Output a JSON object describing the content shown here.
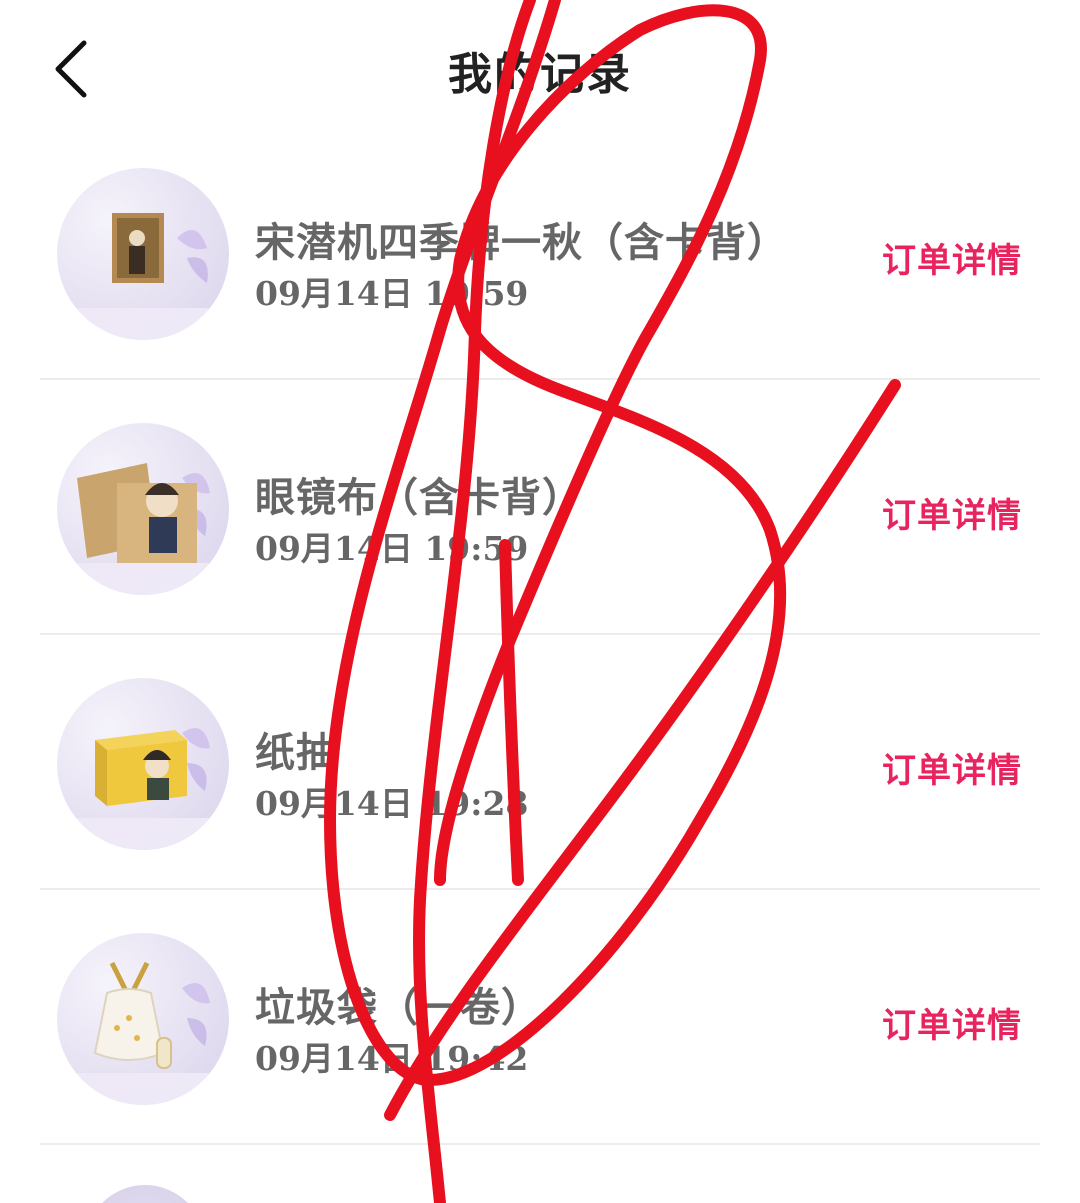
{
  "header": {
    "title": "我的记录",
    "back_icon": "chevron-left-icon"
  },
  "records": [
    {
      "name": "宋潜机四季牌一秋（含卡背）",
      "time": "09月14日 19:59",
      "detail_label": "订单详情",
      "thumb_icon": "card-product-icon"
    },
    {
      "name": "眼镜布（含卡背）",
      "time": "09月14日 19:59",
      "detail_label": "订单详情",
      "thumb_icon": "cloth-product-icon"
    },
    {
      "name": "纸抽",
      "time": "09月14日 19:28",
      "detail_label": "订单详情",
      "thumb_icon": "tissue-box-icon"
    },
    {
      "name": "垃圾袋（一卷）",
      "time": "09月14日 19:42",
      "detail_label": "订单详情",
      "thumb_icon": "trash-bag-icon"
    }
  ],
  "colors": {
    "accent": "#e8245f",
    "scribble": "#e8101e",
    "text": "#666666"
  }
}
